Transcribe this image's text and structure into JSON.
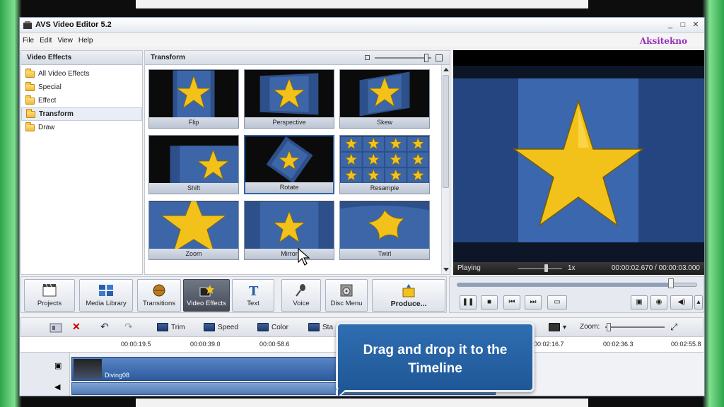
{
  "window": {
    "title": "AVS Video Editor 5.2",
    "controls": [
      "_",
      "□",
      "✕"
    ]
  },
  "menu": {
    "items": [
      "File",
      "Edit",
      "View",
      "Help"
    ],
    "brand": "Aksitekno"
  },
  "left_panel": {
    "heading": "Video Effects",
    "items": [
      {
        "label": "All Video Effects",
        "selected": false
      },
      {
        "label": "Special",
        "selected": false
      },
      {
        "label": "Effect",
        "selected": false
      },
      {
        "label": "Transform",
        "selected": true
      },
      {
        "label": "Draw",
        "selected": false
      }
    ]
  },
  "center_panel": {
    "heading": "Transform",
    "tiles": [
      {
        "label": "Flip"
      },
      {
        "label": "Perspective"
      },
      {
        "label": "Skew"
      },
      {
        "label": "Shift"
      },
      {
        "label": "Rotate",
        "selected": true
      },
      {
        "label": "Resample"
      },
      {
        "label": "Zoom"
      },
      {
        "label": "Mirror"
      },
      {
        "label": "Twirl"
      }
    ]
  },
  "preview": {
    "status": "Playing",
    "speed": "1x",
    "time": "00:00:02.670 / 00:00:03.000",
    "speed_level": 0.6,
    "seek_progress": 0.89
  },
  "toolbar": {
    "buttons": [
      {
        "label": "Projects",
        "icon": "projects-icon",
        "active": false
      },
      {
        "label": "Media Library",
        "icon": "media-library-icon",
        "active": false
      },
      {
        "label": "Transitions",
        "icon": "transitions-icon",
        "active": false
      },
      {
        "label": "Video Effects",
        "icon": "video-effects-icon",
        "active": true
      },
      {
        "label": "Text",
        "icon": "text-icon",
        "active": false
      },
      {
        "label": "Voice",
        "icon": "microphone-icon",
        "active": false
      },
      {
        "label": "Disc Menu",
        "icon": "disc-menu-icon",
        "active": false
      },
      {
        "label": "Produce...",
        "icon": "produce-icon",
        "active": false
      }
    ]
  },
  "timeline": {
    "tools": [
      "Trim",
      "Speed",
      "Color",
      "Sta"
    ],
    "zoom_label": "Zoom:",
    "ruler": [
      "00:00:19.5",
      "00:00:39.0",
      "00:00:58.6",
      "00:02:16.7",
      "00:02:36.3",
      "00:02:55.8"
    ],
    "clip_name": "Diving08"
  },
  "callout": {
    "line1": "Drag and drop it to the",
    "line2": "Timeline"
  },
  "colors": {
    "accent": "#3465a4",
    "callout": "#2a66a8",
    "brand": "#9a2eb8",
    "star": "#f2c21a"
  }
}
